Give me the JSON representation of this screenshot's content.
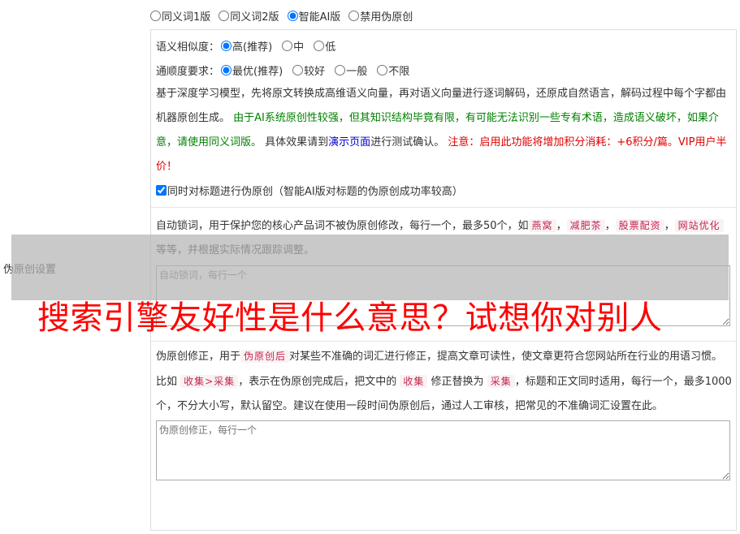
{
  "side_label": "伪原创设置",
  "top_options": [
    {
      "label": "同义词1版",
      "checked": false
    },
    {
      "label": "同义词2版",
      "checked": false
    },
    {
      "label": "智能AI版",
      "checked": true
    },
    {
      "label": "禁用伪原创",
      "checked": false
    }
  ],
  "similarity": {
    "label": "语义相似度：",
    "options": [
      {
        "label": "高(推荐)",
        "checked": true
      },
      {
        "label": "中",
        "checked": false
      },
      {
        "label": "低",
        "checked": false
      }
    ]
  },
  "fluency": {
    "label": "通顺度要求：",
    "options": [
      {
        "label": "最优(推荐)",
        "checked": true
      },
      {
        "label": "较好",
        "checked": false
      },
      {
        "label": "一般",
        "checked": false
      },
      {
        "label": "不限",
        "checked": false
      }
    ]
  },
  "description": {
    "p1": "基于深度学习模型，先将原文转换成高维语义向量，再对语义向量进行逐词解码，还原成自然语言，解码过程中每个字都由机器原创生成。",
    "p2_green": "由于AI系统原创性较强，但其知识结构毕竟有限，有可能无法识别一些专有术语，造成语义破坏，如果介意，请使用同义词版。",
    "p3a": "具体效果请到",
    "p3_link": "演示页面",
    "p3b": "进行测试确认。",
    "p4_red": "注意：启用此功能将增加积分消耗：+6积分/篇。VIP用户半价！"
  },
  "title_checkbox": {
    "label": "同时对标题进行伪原创（智能AI版对标题的伪原创成功率较高）",
    "checked": true
  },
  "lock_words": {
    "text1": "自动锁词，用于保护您的核心产品词不被伪原创修改，每行一个，最多50个，如",
    "examples": [
      "燕窝",
      "减肥茶",
      "股票配资",
      "网站优化"
    ],
    "text2": "等等，并根据实际情况跟踪调整。",
    "placeholder": "自动锁词，每行一个"
  },
  "correction": {
    "t1": "伪原创修正，用于",
    "c1": "伪原创后",
    "t2": "对某些不准确的词汇进行修正，提高文章可读性，使文章更符合您网站所在行业的用语习惯。比如",
    "c2": "收集>采集",
    "t3": "，表示在伪原创完成后，把文中的",
    "c3": "收集",
    "t4": "修正替换为",
    "c4": "采集",
    "t5": "，标题和正文同时适用，每行一个，最多1000个，不分大小写，默认留空。建议在使用一段时间伪原创后，通过人工审核，把常见的不准确词汇设置在此。",
    "placeholder": "伪原创修正，每行一个"
  },
  "overlay_headline": "搜索引擎友好性是什么意思？试想你对别人",
  "colors": {
    "green": "#008000",
    "red": "#e00000",
    "link": "#0000cc",
    "code": "#c7254e",
    "headline": "#ff0000"
  }
}
